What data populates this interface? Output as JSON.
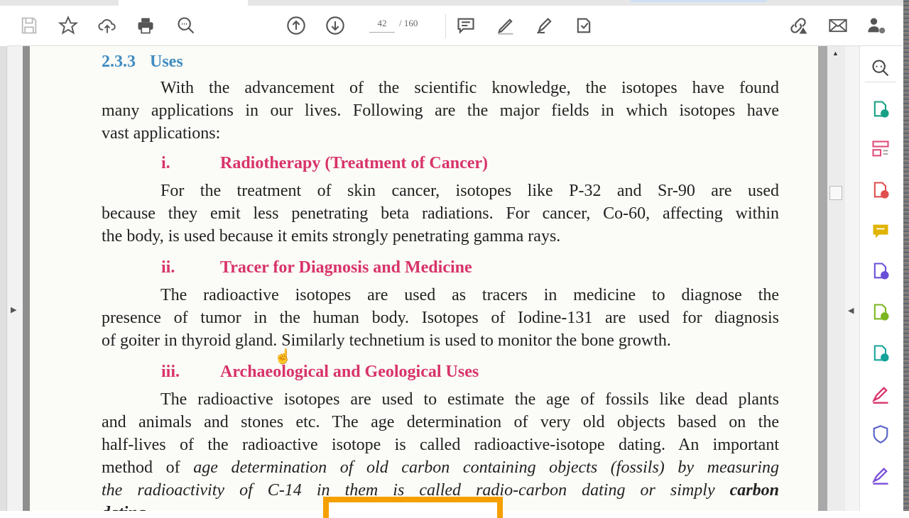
{
  "toolbar": {
    "left_icons": [
      "save-icon",
      "bookmark-star-icon",
      "upload-cloud-icon",
      "print-icon",
      "zoom-search-icon"
    ],
    "page_up_icon": "arrow-up-circle-icon",
    "page_down_icon": "arrow-down-circle-icon",
    "current_page": "42",
    "total_pages": "/ 160",
    "tools": [
      "comment-icon",
      "highlight-pen-icon",
      "sign-pen-icon",
      "stamp-icon"
    ],
    "right_icons": [
      "share-link-icon",
      "email-icon",
      "add-user-icon"
    ]
  },
  "right_panel": {
    "icons": [
      {
        "name": "zoom-find-icon",
        "color": "#444444"
      },
      {
        "name": "export-pdf-icon",
        "color": "#16a085"
      },
      {
        "name": "organize-pages-icon",
        "color": "#e04e7a"
      },
      {
        "name": "create-pdf-icon",
        "color": "#e04e4e"
      },
      {
        "name": "comment-icon",
        "color": "#e0b400"
      },
      {
        "name": "combine-files-icon",
        "color": "#6a4fd8"
      },
      {
        "name": "scan-icon",
        "color": "#7ab520"
      },
      {
        "name": "compress-pdf-icon",
        "color": "#17a39a"
      },
      {
        "name": "fill-sign-icon",
        "color": "#d8336a"
      },
      {
        "name": "protect-icon",
        "color": "#5661c8"
      },
      {
        "name": "request-sign-icon",
        "color": "#7a4fd8"
      }
    ]
  },
  "document": {
    "section_number": "2.3.3",
    "section_title": "Uses",
    "intro_lines": [
      [
        {
          "t": "With the advancement of the scientific knowledge, the isotopes have found"
        }
      ],
      [
        {
          "t": "many applications in our lives. Following are the major fields in which isotopes have"
        }
      ],
      [
        {
          "t": "vast applications:"
        }
      ]
    ],
    "subsections": [
      {
        "number": "i.",
        "title": "Radiotherapy (Treatment of Cancer)",
        "lines": [
          [
            {
              "t": "For the treatment of skin cancer, isotopes like P-32 and Sr-90 are used"
            }
          ],
          [
            {
              "t": "because they emit less penetrating beta radiations. For cancer, Co-60, affecting within"
            }
          ],
          [
            {
              "t": "the body, is used because it emits strongly penetrating gamma rays."
            }
          ]
        ]
      },
      {
        "number": "ii.",
        "title": "Tracer for Diagnosis and Medicine",
        "lines": [
          [
            {
              "t": "The radioactive isotopes are used as tracers in medicine to diagnose the"
            }
          ],
          [
            {
              "t": "presence of tumor in the human body. Isotopes of Iodine-131 are used for diagnosis"
            }
          ],
          [
            {
              "t": "of goiter in thyroid gland. Similarly technetium is used to monitor the bone growth."
            }
          ]
        ]
      },
      {
        "number": "iii.",
        "title": "Archaeological and Geological Uses",
        "lines": [
          [
            {
              "t": "The radioactive isotopes are used to estimate the age of fossils like dead plants"
            }
          ],
          [
            {
              "t": "and animals and stones etc. The age determination of very old objects based on the"
            }
          ],
          [
            {
              "t": "half-lives of the radioactive isotope is called radioactive-isotope dating. An important"
            }
          ],
          [
            {
              "t": "method of "
            },
            {
              "t": "age determination of old carbon containing objects (fossils) by measuring",
              "s": "i"
            }
          ],
          [
            {
              "t": "the radioactivity of C-14 in them is called radio-carbon dating or simply ",
              "s": "i"
            },
            {
              "t": "carbon",
              "s": "bi"
            }
          ],
          [
            {
              "t": "dating.",
              "s": "bi"
            }
          ]
        ]
      }
    ]
  }
}
